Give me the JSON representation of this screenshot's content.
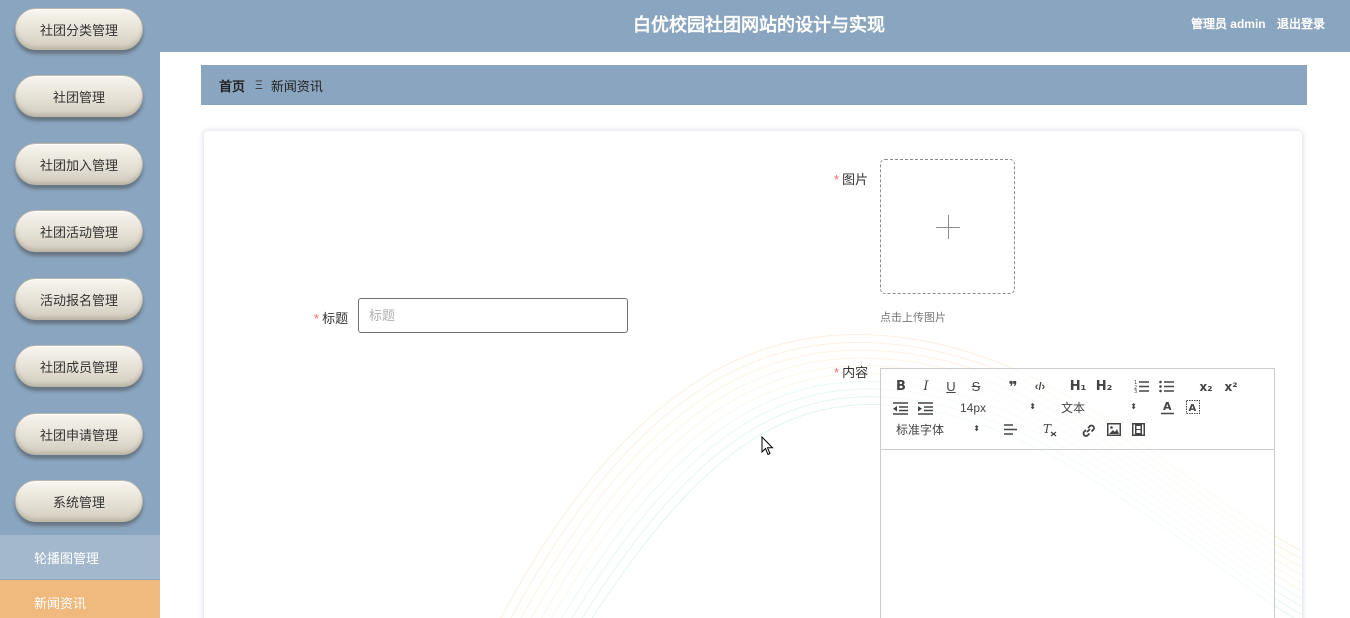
{
  "header": {
    "title": "白优校园社团网站的设计与实现",
    "user_label": "管理员 admin",
    "logout_label": "退出登录"
  },
  "sidebar": {
    "items": [
      {
        "label": "社团分类管理"
      },
      {
        "label": "社团管理"
      },
      {
        "label": "社团加入管理"
      },
      {
        "label": "社团活动管理"
      },
      {
        "label": "活动报名管理"
      },
      {
        "label": "社团成员管理"
      },
      {
        "label": "社团申请管理"
      },
      {
        "label": "系统管理"
      }
    ],
    "sub_items": [
      {
        "label": "轮播图管理",
        "active": false
      },
      {
        "label": "新闻资讯",
        "active": true
      }
    ]
  },
  "breadcrumb": {
    "home": "首页",
    "separator": "Ξ",
    "current": "新闻资讯"
  },
  "form": {
    "title_label": "标题",
    "title_placeholder": "标题",
    "title_value": "",
    "image_label": "图片",
    "upload_tip": "点击上传图片",
    "content_label": "内容",
    "required_mark": "*"
  },
  "editor": {
    "bold": "B",
    "italic": "I",
    "underline": "U",
    "strike": "S",
    "quote": "❞",
    "code": "‹/›",
    "h1": "H₁",
    "h2": "H₂",
    "subscript": "x₂",
    "superscript": "x²",
    "font_size": "14px",
    "header_select": "文本",
    "font_family": "标准字体",
    "select_arrow": "⬍"
  },
  "colors": {
    "primary": "#8aa5bf",
    "sub_inactive": "#a3b8cc",
    "active": "#f0b97e",
    "required": "#f56c6c"
  }
}
